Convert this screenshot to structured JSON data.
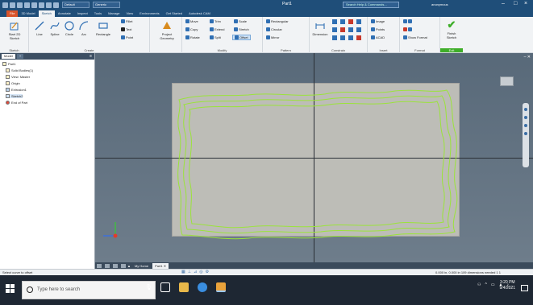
{
  "titlebar": {
    "doc_title": "Part1",
    "search_placeholder": "Search Help & Commands...",
    "user": "anonymous",
    "project_field": "Default",
    "appearance_field": "Generic"
  },
  "tabs": [
    "File",
    "3D Model",
    "Sketch",
    "Annotate",
    "Inspect",
    "Tools",
    "Manage",
    "View",
    "Environments",
    "Get Started",
    "Autodesk CAM"
  ],
  "ribbon": {
    "start_sketch": "Start 2D Sketch",
    "create": {
      "line": "Line",
      "spline": "Spline",
      "circle": "Circle",
      "arc": "Arc",
      "rectangle": "Rectangle",
      "fillet": "Fillet",
      "text": "Text",
      "point": "Point"
    },
    "project_geometry": "Project Geometry",
    "modify": {
      "move": "Move",
      "trim": "Trim",
      "scale": "Scale",
      "copy": "Copy",
      "extend": "Extend",
      "stretch": "Stretch",
      "rotate": "Rotate",
      "split": "Split",
      "offset": "Offset"
    },
    "pattern": {
      "rectangular": "Rectangular",
      "circular": "Circular",
      "mirror": "Mirror"
    },
    "dimension": "Dimension",
    "insert": {
      "image": "Image",
      "points": "Points",
      "acad": "ACAD"
    },
    "format": {
      "show_format": "Show Format"
    },
    "finish_sketch": "Finish Sketch",
    "groups": [
      "Sketch",
      "Create",
      "Modify",
      "Pattern",
      "Constrain",
      "Insert",
      "Format",
      "Exit"
    ]
  },
  "browser": {
    "tabs": [
      "Model",
      "+"
    ],
    "items": [
      "Part1",
      "Solid Bodies(1)",
      "View: Master",
      "Origin",
      "Extrusion1",
      "Sketch2",
      "End of Part"
    ]
  },
  "document_tabs": {
    "home": "My Home",
    "part": "Part1"
  },
  "status": {
    "left": "Select curve to offset",
    "right": "0.000 in, 0.000 in   109 dimensions needed   1   1"
  },
  "taskbar": {
    "search_placeholder": "Type here to search",
    "time": "3:20 PM",
    "date": "9/4/2021"
  },
  "colors": {
    "sketch_curve": "#9be33b",
    "sheet": "#bdbdb7",
    "canvas": "#5f6f7f",
    "accent": "#1f4e79"
  }
}
